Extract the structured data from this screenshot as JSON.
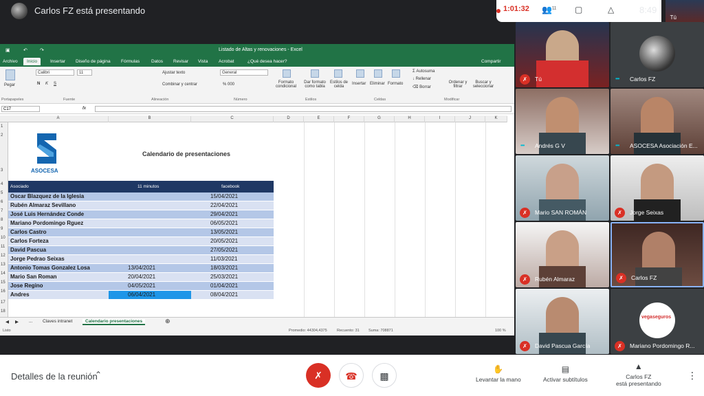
{
  "topbar": {
    "presenter_title": "Carlos FZ está presentando",
    "recording_time": "1:01:32",
    "participant_count": "11",
    "clock": "8:49",
    "self_label": "Tú"
  },
  "excel": {
    "window_title": "Listado de Altas y renovaciones - Excel",
    "tabs": [
      "Archivo",
      "Inicio",
      "Insertar",
      "Diseño de página",
      "Fórmulas",
      "Datos",
      "Revisar",
      "Vista",
      "Acrobat",
      "¿Qué desea hacer?"
    ],
    "share_label": "Compartir",
    "ribbon": {
      "paste": "Pegar",
      "clipboard_group": "Portapapeles",
      "font_name": "Calibri",
      "font_size": "11",
      "font_group": "Fuente",
      "wrap_text": "Ajustar texto",
      "merge_center": "Combinar y centrar",
      "alignment_group": "Alineación",
      "number_format": "General",
      "number_group": "Número",
      "conditional_format": "Formato condicional",
      "format_table": "Dar formato como tabla",
      "cell_styles": "Estilos de celda",
      "styles_group": "Estilos",
      "insert": "Insertar",
      "delete": "Eliminar",
      "format": "Formato",
      "cells_group": "Celdas",
      "autosum": "Autosuma",
      "fill": "Rellenar",
      "clear": "Borrar",
      "sort_filter": "Ordenar y filtrar",
      "find_select": "Buscar y seleccionar",
      "modify_group": "Modificar"
    },
    "name_box": "C17",
    "columns": [
      "A",
      "B",
      "C",
      "D",
      "E",
      "F",
      "G",
      "H",
      "I",
      "J",
      "K"
    ],
    "rows": [
      "1",
      "2",
      "3",
      "4",
      "5",
      "6",
      "7",
      "8",
      "9",
      "10",
      "11",
      "12",
      "13",
      "14",
      "15",
      "16",
      "17",
      "18"
    ],
    "logo_text": "ASOCESA",
    "sheet_title": "Calendario de presentaciones",
    "table_headers": [
      "Asociado",
      "11 minutos",
      "facebook"
    ],
    "table_rows": [
      {
        "a": "Oscar Blazquez de la Iglesia",
        "b": "",
        "c": "15/04/2021"
      },
      {
        "a": "Rubén Almaraz Sevillano",
        "b": "",
        "c": "22/04/2021"
      },
      {
        "a": "José Luis Hernández Conde",
        "b": "",
        "c": "29/04/2021"
      },
      {
        "a": "Mariano Pordomingo Rguez",
        "b": "",
        "c": "06/05/2021"
      },
      {
        "a": "Carlos Castro",
        "b": "",
        "c": "13/05/2021"
      },
      {
        "a": "Carlos Forteza",
        "b": "",
        "c": "20/05/2021"
      },
      {
        "a": "David Pascua",
        "b": "",
        "c": "27/05/2021"
      },
      {
        "a": "Jorge Pedrao Seixas",
        "b": "",
        "c": "11/03/2021"
      },
      {
        "a": "Antonio Tomas Gonzalez Losa",
        "b": "13/04/2021",
        "c": "18/03/2021"
      },
      {
        "a": "Mario San Roman",
        "b": "20/04/2021",
        "c": "25/03/2021"
      },
      {
        "a": "Jose Regino",
        "b": "04/05/2021",
        "c": "01/04/2021"
      },
      {
        "a": "Andres",
        "b": "06/04/2021",
        "c": "08/04/2021"
      }
    ],
    "sheet_tabs": [
      "...",
      "Claves intranet",
      "Calendario presentaciones"
    ],
    "status": {
      "ready": "Listo",
      "average": "Promedio: 44304,4375",
      "count": "Recuento: 31",
      "sum": "Suma: 708871",
      "zoom": "100 %"
    }
  },
  "participants": [
    {
      "name": "Tú",
      "muted": true
    },
    {
      "name": "Carlos FZ",
      "muted": false
    },
    {
      "name": "Andrés G V",
      "muted": false
    },
    {
      "name": "ASOCESA Asociación E...",
      "muted": false
    },
    {
      "name": "Mario SAN ROMÁN",
      "muted": true
    },
    {
      "name": "Jorge Seixas",
      "muted": true
    },
    {
      "name": "Rubén Almaraz",
      "muted": true
    },
    {
      "name": "Carlos FZ",
      "muted": true
    },
    {
      "name": "David Pascua García",
      "muted": true
    },
    {
      "name": "Mariano Pordomingo R...",
      "muted": true
    }
  ],
  "vegaseguros_logo": "vegaseguros",
  "bottombar": {
    "meeting_details": "Detalles de la reunión",
    "raise_hand": "Levantar la mano",
    "captions": "Activar subtítulos",
    "presenting_line1": "Carlos FZ",
    "presenting_line2": "está presentando"
  }
}
